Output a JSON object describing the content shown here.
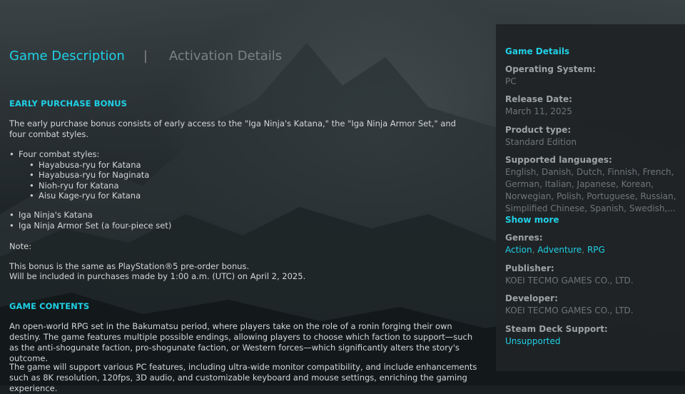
{
  "tabs": [
    {
      "label": "Game Description"
    },
    {
      "label": "Activation Details"
    }
  ],
  "tab_separator": "|",
  "early_bonus": {
    "heading": "EARLY PURCHASE BONUS",
    "intro": "The early purchase bonus consists of early access to the \"Iga Ninja's Katana,\" the \"Iga Ninja Armor Set,\" and four combat styles.",
    "combat_styles_label": "Four combat styles:",
    "combat_styles": [
      "Hayabusa-ryu for Katana",
      "Hayabusa-ryu for Naginata",
      "Nioh-ryu for Katana",
      "Aisu Kage-ryu for Katana"
    ],
    "items": [
      "Iga Ninja's Katana",
      "Iga Ninja Armor Set (a four-piece set)"
    ],
    "note_label": "Note:",
    "note_line1": "This bonus is the same as PlayStation®5 pre-order bonus.",
    "note_line2": "Will be included in purchases made by 1:00 a.m. (UTC) on April 2, 2025."
  },
  "game_contents": {
    "heading": "GAME CONTENTS",
    "para1": "An open-world RPG set in the Bakumatsu period, where players take on the role of a ronin forging their own destiny. The game features multiple possible endings, allowing players to choose which faction to support—such as the anti-shogunate faction, pro-shogunate faction, or Western forces—which significantly alters the story's outcome.",
    "para2": "The game will support various PC features, including ultra-wide monitor compatibility, and include enhancements such as 8K resolution, 120fps, 3D audio, and customizable keyboard and mouse settings, enriching the gaming experience."
  },
  "details": {
    "title": "Game Details",
    "os_label": "Operating System:",
    "os_value": "PC",
    "release_label": "Release Date:",
    "release_value": "March 11, 2025",
    "type_label": "Product type:",
    "type_value": "Standard Edition",
    "languages_label": "Supported languages:",
    "languages_value": "English, Danish, Dutch, Finnish, French, German, Italian, Japanese, Korean, Norwegian, Polish, Portuguese, Russian, Simplified Chinese, Spanish, Swedish,...",
    "show_more": "Show more",
    "genres_label": "Genres:",
    "genres": [
      "Action",
      "Adventure",
      "RPG"
    ],
    "publisher_label": "Publisher:",
    "publisher_value": "KOEI TECMO GAMES CO., LTD.",
    "developer_label": "Developer:",
    "developer_value": "KOEI TECMO GAMES CO., LTD.",
    "deck_label": "Steam Deck Support:",
    "deck_value": "Unsupported"
  },
  "colors": {
    "accent": "#1fd0e6",
    "text": "#d4d6d7",
    "muted": "#6f7578"
  }
}
